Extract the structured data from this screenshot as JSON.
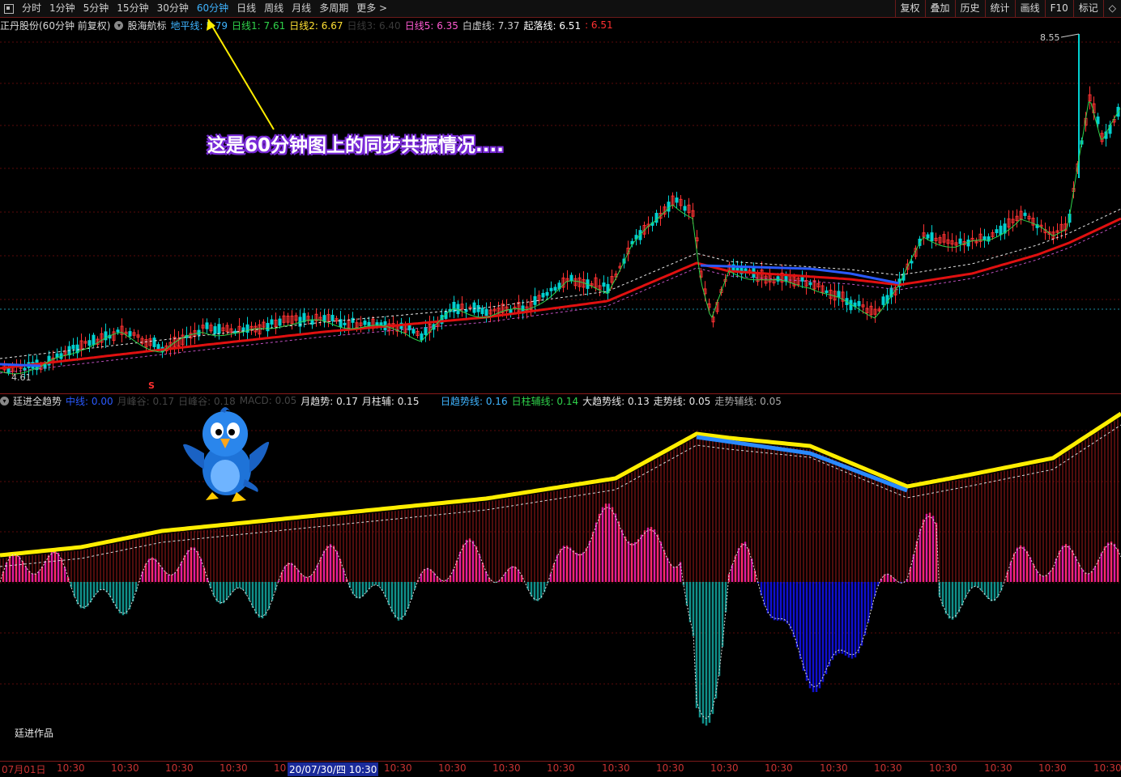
{
  "toolbar": {
    "periods": [
      "分时",
      "1分钟",
      "5分钟",
      "15分钟",
      "30分钟",
      "60分钟",
      "日线",
      "周线",
      "月线",
      "多周期",
      "更多 >"
    ],
    "active_period": "60分钟",
    "right_buttons": [
      "复权",
      "叠加",
      "历史",
      "统计",
      "画线",
      "F10",
      "标记",
      "◇"
    ]
  },
  "main_info": {
    "title": "正丹股份(60分钟 前复权)",
    "indicator_name": "股海航标",
    "items": [
      {
        "label": "地平线: 5.79",
        "color": "#3fb4ff"
      },
      {
        "label": "日线1: 7.61",
        "color": "#2fd24a"
      },
      {
        "label": "日线2: 6.67",
        "color": "#ffe033"
      },
      {
        "label": "日线3: 6.40",
        "color": "#3a3a3a"
      },
      {
        "label": "日线5: 6.35",
        "color": "#ff5ad2"
      },
      {
        "label": "白虚线: 7.37",
        "color": "#cfcfcf"
      },
      {
        "label": "起落线: 6.51",
        "color": "#ffffff"
      },
      {
        "label": ": 6.51",
        "color": "#ff3030"
      }
    ]
  },
  "price_labels": {
    "high": "8.55",
    "low": "4.61"
  },
  "annotation": "这是60分钟图上的同步共振情况....",
  "signal_marker": "S",
  "sub_info": {
    "indicator_name": "廷进全趋势",
    "items": [
      {
        "label": "中线: 0.00",
        "color": "#2a5aff"
      },
      {
        "label": "月峰谷: 0.17",
        "color": "#444"
      },
      {
        "label": "日峰谷: 0.18",
        "color": "#444"
      },
      {
        "label": "MACD: 0.05",
        "color": "#444"
      },
      {
        "label": "月趋势: 0.17",
        "color": "#e8e8e8"
      },
      {
        "label": "月柱辅: 0.15",
        "color": "#e8e8e8"
      }
    ],
    "items2": [
      {
        "label": "日趋势线: 0.16",
        "color": "#3fb4ff"
      },
      {
        "label": "日柱辅线: 0.14",
        "color": "#2fd24a"
      },
      {
        "label": "大趋势线: 0.13",
        "color": "#e8e8e8"
      },
      {
        "label": "走势线: 0.05",
        "color": "#e8e8e8"
      },
      {
        "label": "走势辅线: 0.05",
        "color": "#aaa"
      }
    ]
  },
  "watermark": "廷进作品",
  "time_axis": {
    "ticks": [
      "07月01日",
      "10:30",
      "10:30",
      "10:30",
      "10:30",
      "10",
      "10:30",
      "10:30",
      "10:30",
      "10:30",
      "10:30",
      "10:30",
      "10:30",
      "10:30",
      "10:30",
      "10:30",
      "10:30",
      "10:30",
      "10:30",
      "10:30"
    ],
    "highlight": "20/07/30/四 10:30"
  },
  "colors": {
    "up": "#ff3232",
    "down": "#00d0d0",
    "ma_red": "#e01010",
    "accent": "#3fb4ff"
  }
}
